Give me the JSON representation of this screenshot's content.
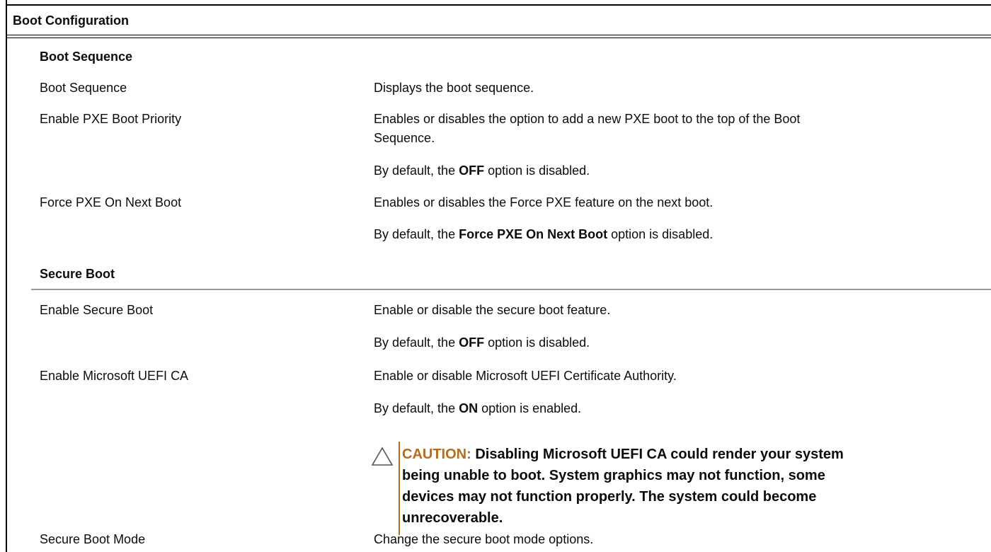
{
  "title": "Boot Configuration",
  "sections": [
    {
      "heading": "Boot Sequence",
      "rows": [
        {
          "label": "Boot Sequence",
          "desc": [
            "Displays the boot sequence."
          ]
        },
        {
          "label": "Enable PXE Boot Priority",
          "desc": [
            "Enables or disables the option to add a new PXE boot to the top of the Boot",
            "Sequence."
          ],
          "default": {
            "prefix": "By default, the ",
            "bold": "OFF",
            "suffix": " option is disabled."
          }
        },
        {
          "label": "Force PXE On Next Boot",
          "desc": [
            "Enables or disables the Force PXE feature on the next boot."
          ],
          "default": {
            "prefix": "By default, the ",
            "bold": "Force PXE On Next Boot",
            "suffix": " option is disabled."
          }
        }
      ]
    },
    {
      "heading": "Secure Boot",
      "rows": [
        {
          "label": "Enable Secure Boot",
          "desc": [
            "Enable or disable the secure boot feature."
          ],
          "default": {
            "prefix": "By default, the ",
            "bold": "OFF",
            "suffix": " option is disabled."
          }
        },
        {
          "label": "Enable Microsoft UEFI CA",
          "desc": [
            "Enable or disable Microsoft UEFI Certificate Authority."
          ],
          "default": {
            "prefix": "By default, the ",
            "bold": "ON",
            "suffix": " option is enabled."
          },
          "caution": {
            "label": "CAUTION:",
            "lines": [
              " Disabling Microsoft UEFI CA could render your system",
              "being unable to boot. System graphics may not function, some",
              "devices may not function properly. The system could become",
              "unrecoverable."
            ]
          }
        },
        {
          "label": "Secure Boot Mode",
          "desc": [
            "Change the secure boot mode options."
          ]
        }
      ]
    }
  ],
  "colors": {
    "caution": "#b86a1d",
    "rule": "#9a9a9a"
  },
  "icons": {
    "caution": "warning-triangle-icon"
  }
}
